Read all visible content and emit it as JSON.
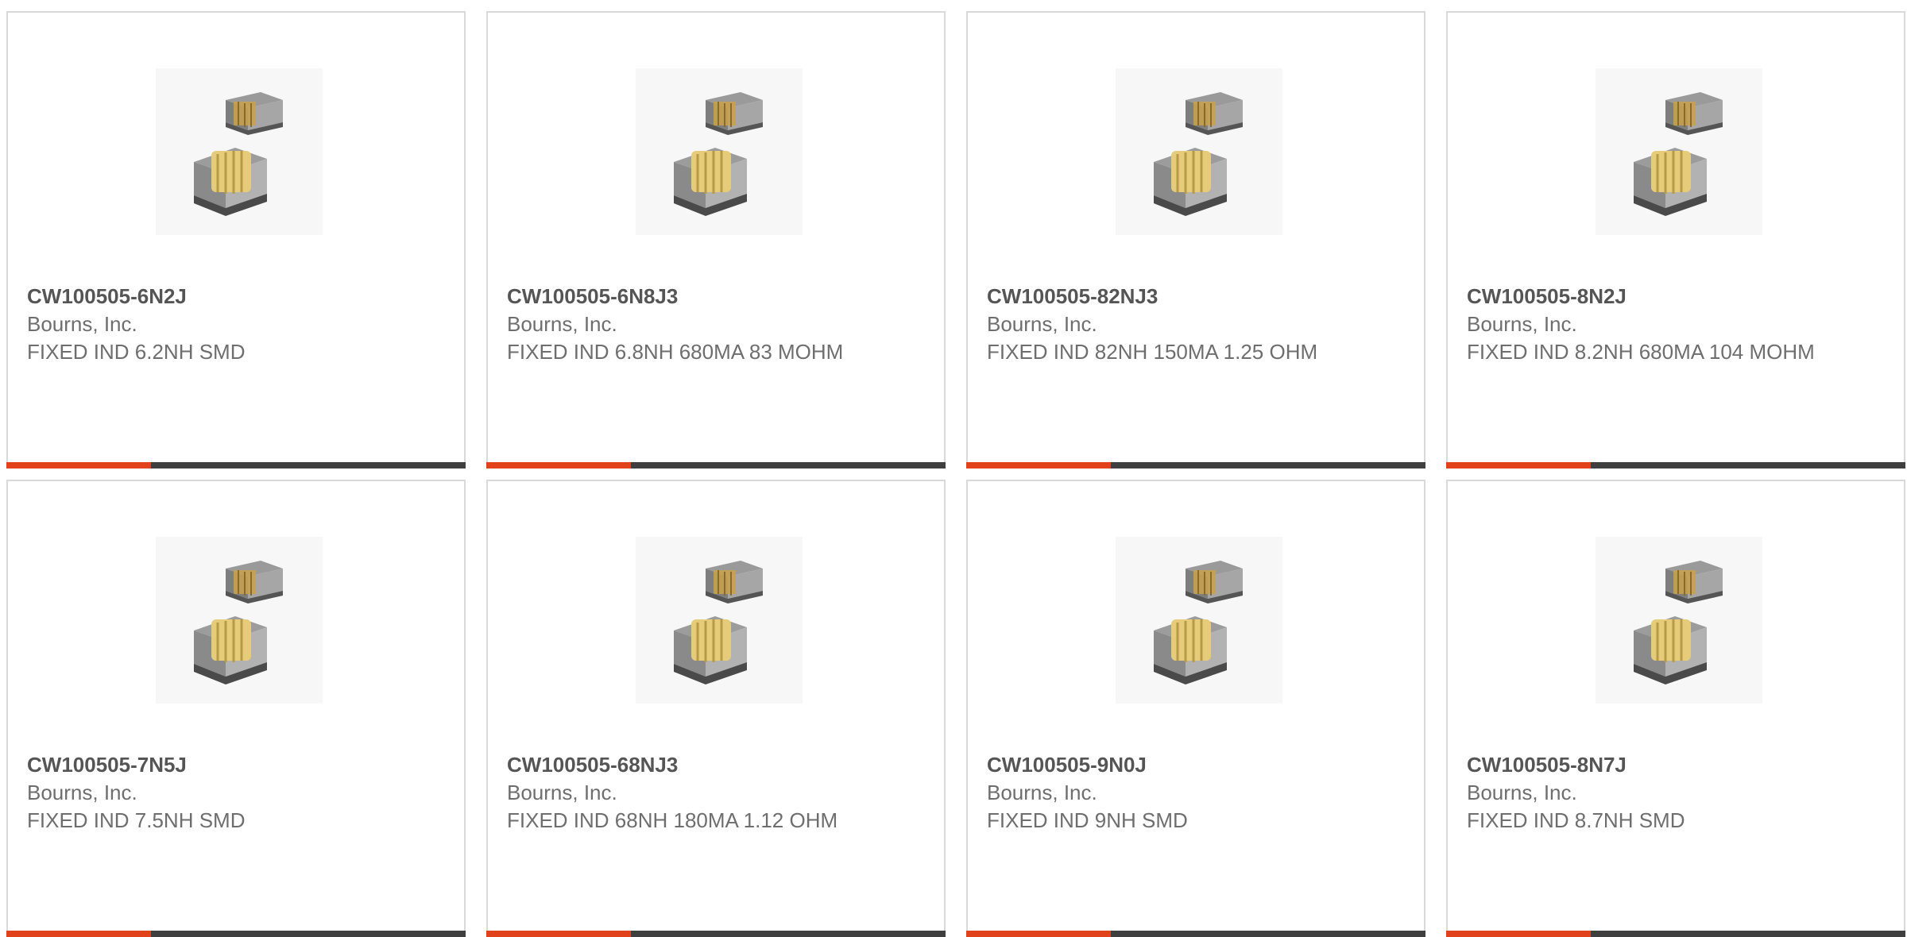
{
  "product_cards": [
    {
      "part_number": "CW100505-6N2J",
      "manufacturer": "Bourns, Inc.",
      "description": "FIXED IND 6.2NH SMD",
      "image_icon": "smd-inductor-icon"
    },
    {
      "part_number": "CW100505-6N8J3",
      "manufacturer": "Bourns, Inc.",
      "description": "FIXED IND 6.8NH 680MA 83 MOHM",
      "image_icon": "smd-inductor-icon"
    },
    {
      "part_number": "CW100505-82NJ3",
      "manufacturer": "Bourns, Inc.",
      "description": "FIXED IND 82NH 150MA 1.25 OHM",
      "image_icon": "smd-inductor-icon"
    },
    {
      "part_number": "CW100505-8N2J",
      "manufacturer": "Bourns, Inc.",
      "description": "FIXED IND 8.2NH 680MA 104 MOHM",
      "image_icon": "smd-inductor-icon"
    },
    {
      "part_number": "CW100505-7N5J",
      "manufacturer": "Bourns, Inc.",
      "description": "FIXED IND 7.5NH SMD",
      "image_icon": "smd-inductor-icon"
    },
    {
      "part_number": "CW100505-68NJ3",
      "manufacturer": "Bourns, Inc.",
      "description": "FIXED IND 68NH 180MA 1.12 OHM",
      "image_icon": "smd-inductor-icon"
    },
    {
      "part_number": "CW100505-9N0J",
      "manufacturer": "Bourns, Inc.",
      "description": "FIXED IND 9NH SMD",
      "image_icon": "smd-inductor-icon"
    },
    {
      "part_number": "CW100505-8N7J",
      "manufacturer": "Bourns, Inc.",
      "description": "FIXED IND 8.7NH SMD",
      "image_icon": "smd-inductor-icon"
    }
  ],
  "colors": {
    "accent": "#e2421b",
    "bar": "#3f3f3f",
    "border": "#d9d9d9",
    "text": "#6e6e6e"
  }
}
